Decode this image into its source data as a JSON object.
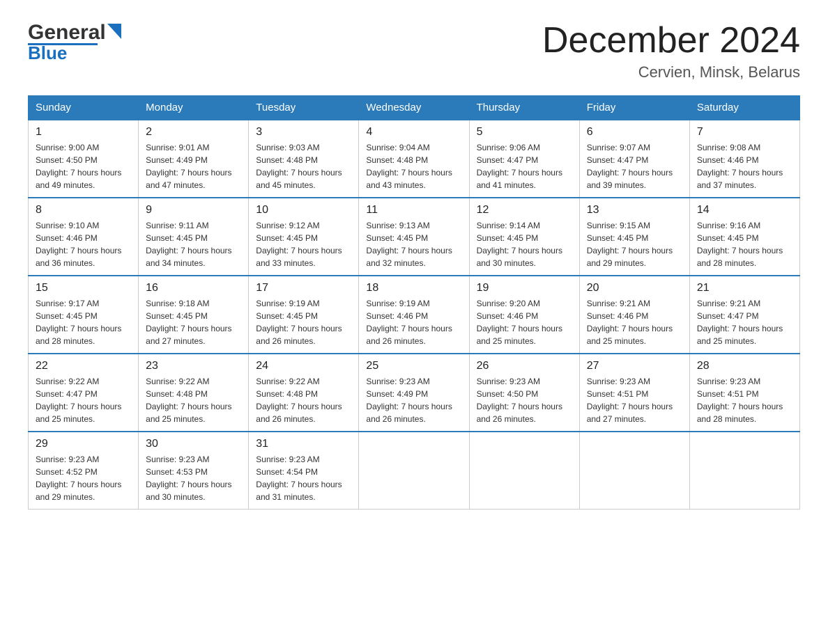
{
  "logo": {
    "name_part1": "General",
    "name_part2": "Blue"
  },
  "header": {
    "month_year": "December 2024",
    "location": "Cervien, Minsk, Belarus"
  },
  "weekdays": [
    "Sunday",
    "Monday",
    "Tuesday",
    "Wednesday",
    "Thursday",
    "Friday",
    "Saturday"
  ],
  "weeks": [
    [
      {
        "day": "1",
        "sunrise": "9:00 AM",
        "sunset": "4:50 PM",
        "daylight": "7 hours and 49 minutes."
      },
      {
        "day": "2",
        "sunrise": "9:01 AM",
        "sunset": "4:49 PM",
        "daylight": "7 hours and 47 minutes."
      },
      {
        "day": "3",
        "sunrise": "9:03 AM",
        "sunset": "4:48 PM",
        "daylight": "7 hours and 45 minutes."
      },
      {
        "day": "4",
        "sunrise": "9:04 AM",
        "sunset": "4:48 PM",
        "daylight": "7 hours and 43 minutes."
      },
      {
        "day": "5",
        "sunrise": "9:06 AM",
        "sunset": "4:47 PM",
        "daylight": "7 hours and 41 minutes."
      },
      {
        "day": "6",
        "sunrise": "9:07 AM",
        "sunset": "4:47 PM",
        "daylight": "7 hours and 39 minutes."
      },
      {
        "day": "7",
        "sunrise": "9:08 AM",
        "sunset": "4:46 PM",
        "daylight": "7 hours and 37 minutes."
      }
    ],
    [
      {
        "day": "8",
        "sunrise": "9:10 AM",
        "sunset": "4:46 PM",
        "daylight": "7 hours and 36 minutes."
      },
      {
        "day": "9",
        "sunrise": "9:11 AM",
        "sunset": "4:45 PM",
        "daylight": "7 hours and 34 minutes."
      },
      {
        "day": "10",
        "sunrise": "9:12 AM",
        "sunset": "4:45 PM",
        "daylight": "7 hours and 33 minutes."
      },
      {
        "day": "11",
        "sunrise": "9:13 AM",
        "sunset": "4:45 PM",
        "daylight": "7 hours and 32 minutes."
      },
      {
        "day": "12",
        "sunrise": "9:14 AM",
        "sunset": "4:45 PM",
        "daylight": "7 hours and 30 minutes."
      },
      {
        "day": "13",
        "sunrise": "9:15 AM",
        "sunset": "4:45 PM",
        "daylight": "7 hours and 29 minutes."
      },
      {
        "day": "14",
        "sunrise": "9:16 AM",
        "sunset": "4:45 PM",
        "daylight": "7 hours and 28 minutes."
      }
    ],
    [
      {
        "day": "15",
        "sunrise": "9:17 AM",
        "sunset": "4:45 PM",
        "daylight": "7 hours and 28 minutes."
      },
      {
        "day": "16",
        "sunrise": "9:18 AM",
        "sunset": "4:45 PM",
        "daylight": "7 hours and 27 minutes."
      },
      {
        "day": "17",
        "sunrise": "9:19 AM",
        "sunset": "4:45 PM",
        "daylight": "7 hours and 26 minutes."
      },
      {
        "day": "18",
        "sunrise": "9:19 AM",
        "sunset": "4:46 PM",
        "daylight": "7 hours and 26 minutes."
      },
      {
        "day": "19",
        "sunrise": "9:20 AM",
        "sunset": "4:46 PM",
        "daylight": "7 hours and 25 minutes."
      },
      {
        "day": "20",
        "sunrise": "9:21 AM",
        "sunset": "4:46 PM",
        "daylight": "7 hours and 25 minutes."
      },
      {
        "day": "21",
        "sunrise": "9:21 AM",
        "sunset": "4:47 PM",
        "daylight": "7 hours and 25 minutes."
      }
    ],
    [
      {
        "day": "22",
        "sunrise": "9:22 AM",
        "sunset": "4:47 PM",
        "daylight": "7 hours and 25 minutes."
      },
      {
        "day": "23",
        "sunrise": "9:22 AM",
        "sunset": "4:48 PM",
        "daylight": "7 hours and 25 minutes."
      },
      {
        "day": "24",
        "sunrise": "9:22 AM",
        "sunset": "4:48 PM",
        "daylight": "7 hours and 26 minutes."
      },
      {
        "day": "25",
        "sunrise": "9:23 AM",
        "sunset": "4:49 PM",
        "daylight": "7 hours and 26 minutes."
      },
      {
        "day": "26",
        "sunrise": "9:23 AM",
        "sunset": "4:50 PM",
        "daylight": "7 hours and 26 minutes."
      },
      {
        "day": "27",
        "sunrise": "9:23 AM",
        "sunset": "4:51 PM",
        "daylight": "7 hours and 27 minutes."
      },
      {
        "day": "28",
        "sunrise": "9:23 AM",
        "sunset": "4:51 PM",
        "daylight": "7 hours and 28 minutes."
      }
    ],
    [
      {
        "day": "29",
        "sunrise": "9:23 AM",
        "sunset": "4:52 PM",
        "daylight": "7 hours and 29 minutes."
      },
      {
        "day": "30",
        "sunrise": "9:23 AM",
        "sunset": "4:53 PM",
        "daylight": "7 hours and 30 minutes."
      },
      {
        "day": "31",
        "sunrise": "9:23 AM",
        "sunset": "4:54 PM",
        "daylight": "7 hours and 31 minutes."
      },
      null,
      null,
      null,
      null
    ]
  ]
}
